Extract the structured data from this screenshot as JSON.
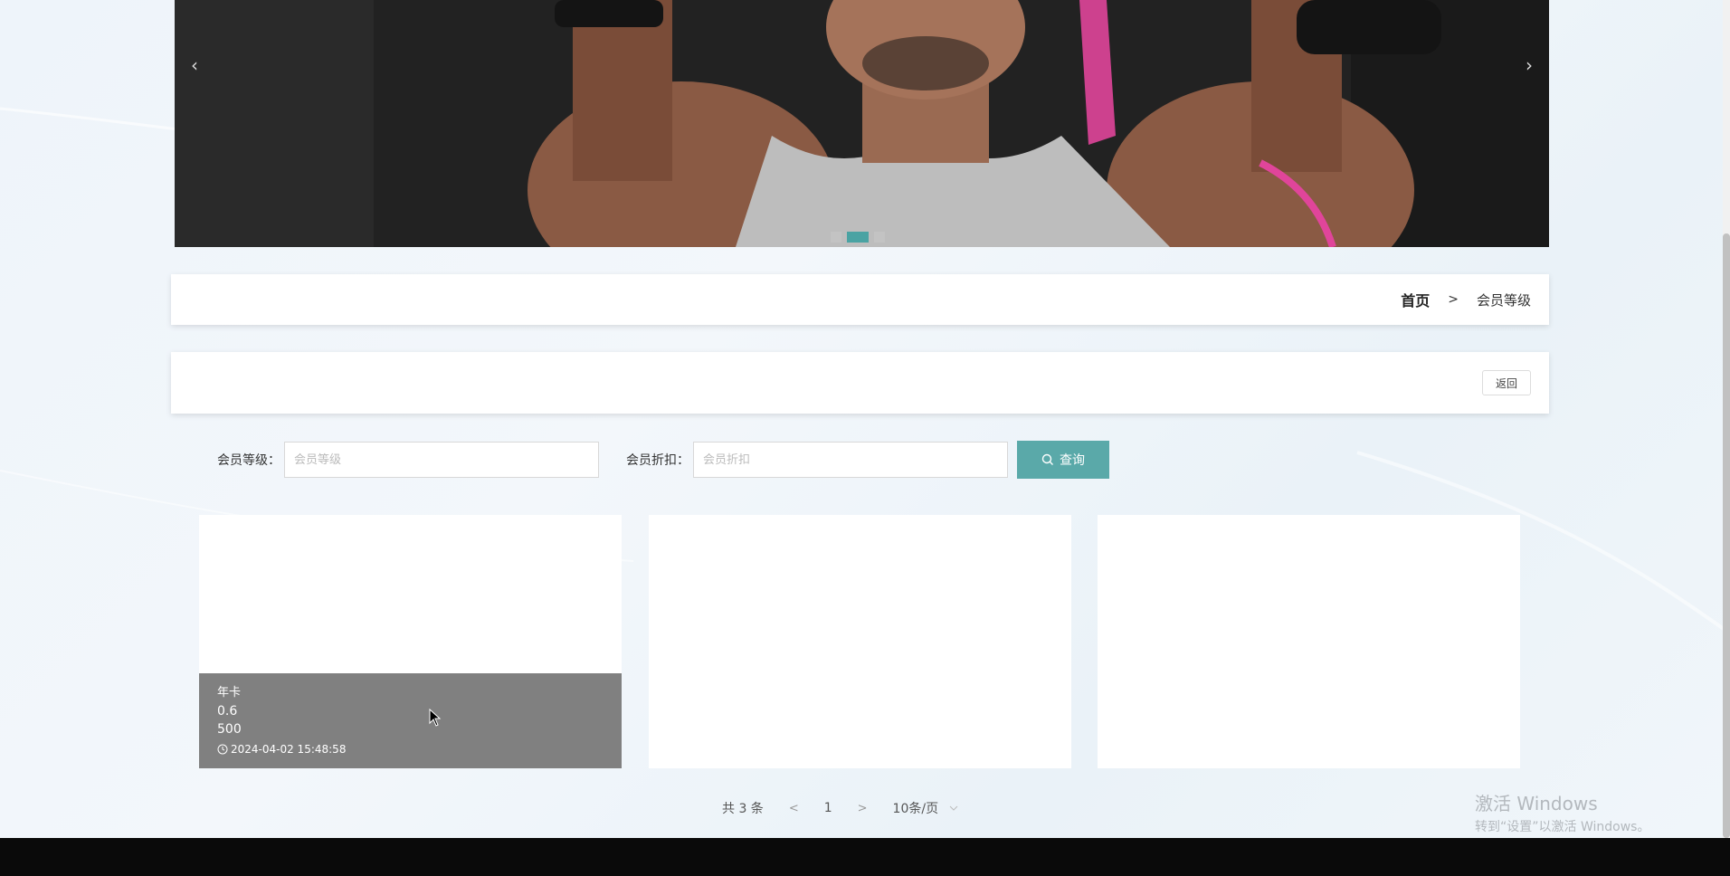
{
  "banner": {
    "prev_label": "‹",
    "next_label": "›",
    "dots": [
      false,
      true,
      false
    ]
  },
  "breadcrumb": {
    "home": "首页",
    "separator": ">",
    "current": "会员等级"
  },
  "actions": {
    "back_label": "返回"
  },
  "search": {
    "level_label": "会员等级：",
    "level_placeholder": "会员等级",
    "discount_label": "会员折扣：",
    "discount_placeholder": "会员折扣",
    "query_label": "查询"
  },
  "cards": [
    {
      "level": "年卡",
      "discount": "0.6",
      "price": "500",
      "time": "2024-04-02 15:48:58"
    }
  ],
  "pagination": {
    "total": "共 3 条",
    "prev": "<",
    "page": "1",
    "next": ">",
    "page_size": "10条/页"
  },
  "watermark": {
    "line1": "激活 Windows",
    "line2": "转到“设置”以激活 Windows。"
  },
  "colors": {
    "accent": "#5aa9a9",
    "overlay": "#808080"
  }
}
